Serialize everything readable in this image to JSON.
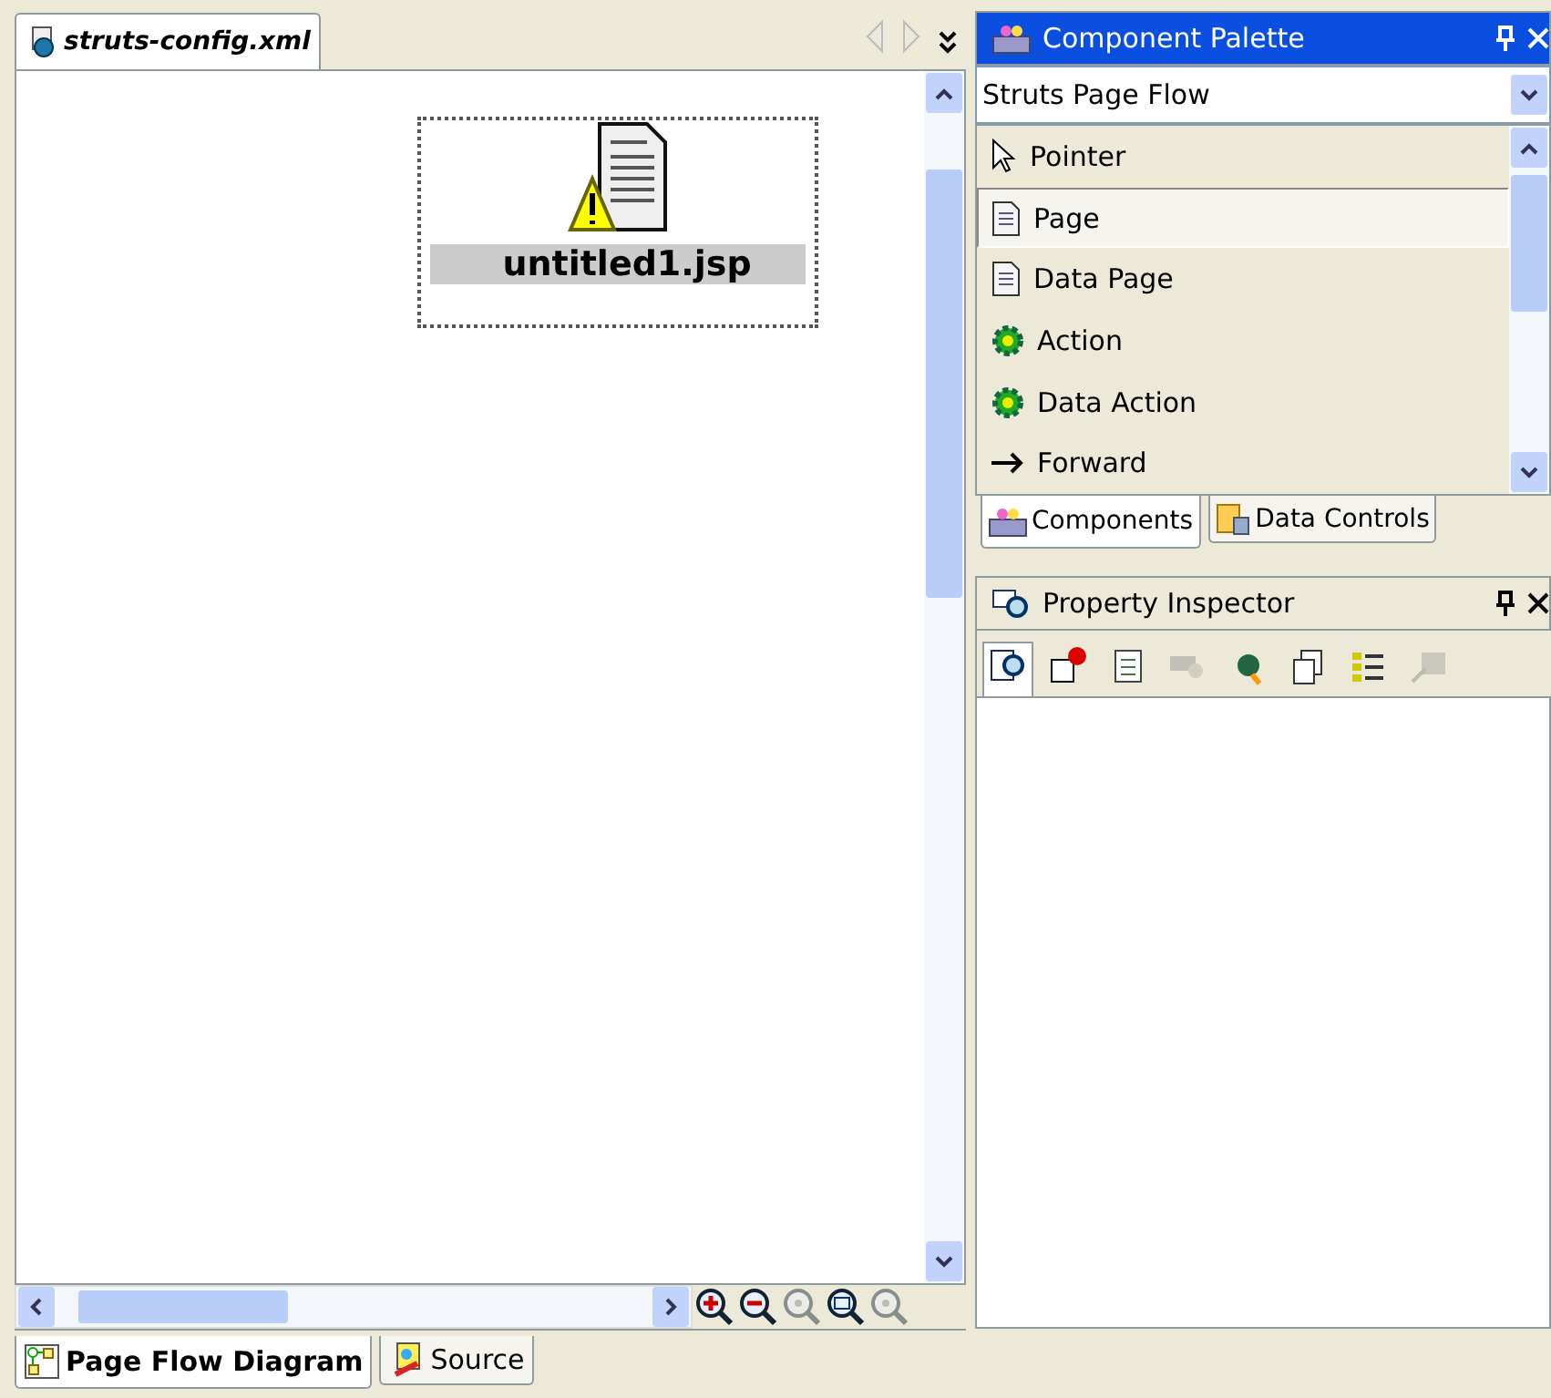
{
  "editor_tab": {
    "label": "struts-config.xml",
    "selected": true
  },
  "diagram_node": {
    "label": "untitled1.jsp",
    "selected": true,
    "warning": true
  },
  "zoom_tools": [
    {
      "kind": "zoom-in",
      "disabled": false
    },
    {
      "kind": "zoom-out",
      "disabled": false
    },
    {
      "kind": "zoom",
      "disabled": true
    },
    {
      "kind": "fit",
      "disabled": false
    },
    {
      "kind": "zoom-selection",
      "disabled": true
    }
  ],
  "bottom_tabs": [
    {
      "label": "Page Flow Diagram",
      "kind": "diagram",
      "selected": true
    },
    {
      "label": "Source",
      "kind": "source",
      "selected": false
    }
  ],
  "component_palette": {
    "title": "Component Palette",
    "category": "Struts Page Flow",
    "items": [
      {
        "label": "Pointer",
        "kind": "pointer",
        "selected": false
      },
      {
        "label": "Page",
        "kind": "page",
        "selected": true
      },
      {
        "label": "Data Page",
        "kind": "data-page",
        "selected": false
      },
      {
        "label": "Action",
        "kind": "action",
        "selected": false
      },
      {
        "label": "Data Action",
        "kind": "data-action",
        "selected": false
      },
      {
        "label": "Forward",
        "kind": "forward",
        "selected": false
      }
    ],
    "tabs": [
      {
        "label": "Components",
        "kind": "components",
        "selected": true
      },
      {
        "label": "Data Controls",
        "kind": "data",
        "selected": false
      }
    ]
  },
  "property_inspector": {
    "title": "Property Inspector",
    "tools": [
      {
        "kind": "inspect",
        "selected": true,
        "disabled": false
      },
      {
        "kind": "pin",
        "selected": false,
        "disabled": false
      },
      {
        "kind": "list",
        "selected": false,
        "disabled": false
      },
      {
        "kind": "find",
        "selected": false,
        "disabled": true
      },
      {
        "kind": "bug",
        "selected": false,
        "disabled": false
      },
      {
        "kind": "copy",
        "selected": false,
        "disabled": false
      },
      {
        "kind": "tree",
        "selected": false,
        "disabled": false
      },
      {
        "kind": "goto",
        "selected": false,
        "disabled": true
      }
    ]
  }
}
